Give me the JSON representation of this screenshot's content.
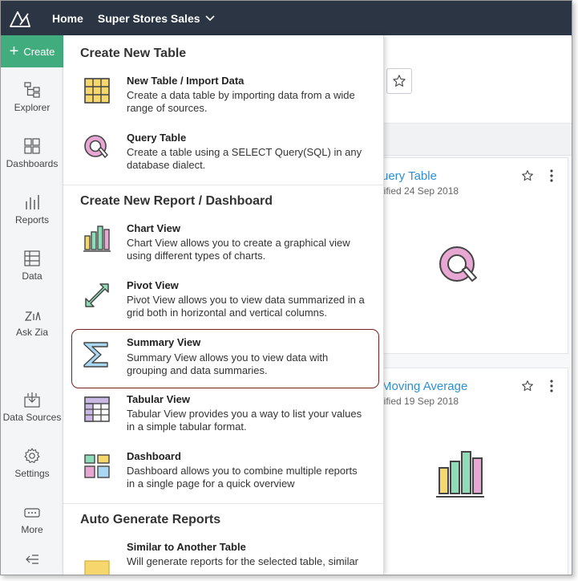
{
  "topbar": {
    "home_label": "Home",
    "workspace_label": "Super Stores Sales"
  },
  "sidebar": {
    "create_label": "Create",
    "items": [
      {
        "label": "Explorer",
        "icon": "explorer-icon"
      },
      {
        "label": "Dashboards",
        "icon": "dashboards-icon"
      },
      {
        "label": "Reports",
        "icon": "reports-icon"
      },
      {
        "label": "Data",
        "icon": "data-icon"
      },
      {
        "label": "Ask Zia",
        "icon": "zia-icon"
      },
      {
        "label": "Data Sources",
        "icon": "data-sources-icon"
      },
      {
        "label": "Settings",
        "icon": "settings-icon"
      },
      {
        "label": "More",
        "icon": "more-icon"
      }
    ]
  },
  "background": {
    "cards": [
      {
        "title": "uery Table",
        "subtitle": "lified 24 Sep 2018",
        "icon": "query-table-icon"
      },
      {
        "title": "Moving Average",
        "subtitle": "lified 19 Sep 2018",
        "icon": "chart-view-icon"
      }
    ]
  },
  "menu": {
    "sections": [
      {
        "title": "Create New Table",
        "items": [
          {
            "title": "New Table / Import Data",
            "desc": "Create a data table by importing data from a wide range of sources.",
            "icon": "table-grid-icon"
          },
          {
            "title": "Query Table",
            "desc": "Create a table using a SELECT Query(SQL) in any database dialect.",
            "icon": "query-table-icon"
          }
        ]
      },
      {
        "title": "Create New Report / Dashboard",
        "items": [
          {
            "title": "Chart View",
            "desc": "Chart View allows you to create a graphical view using different types of charts.",
            "icon": "chart-view-icon"
          },
          {
            "title": "Pivot View",
            "desc": "Pivot View allows you to view data summarized in a grid both in horizontal and vertical columns.",
            "icon": "pivot-view-icon"
          },
          {
            "title": "Summary View",
            "desc": "Summary View allows you to view data with grouping and data summaries.",
            "icon": "summary-sigma-icon",
            "highlighted": true
          },
          {
            "title": "Tabular View",
            "desc": "Tabular View provides you a way to list your values in a simple tabular format.",
            "icon": "tabular-view-icon"
          },
          {
            "title": "Dashboard",
            "desc": "Dashboard allows you to combine multiple reports in a single page for a quick overview",
            "icon": "dashboard-tiles-icon"
          }
        ]
      },
      {
        "title": "Auto Generate Reports",
        "items": [
          {
            "title": "Similar to Another Table",
            "desc": "Will generate reports for the selected table, similar",
            "icon": "auto-generate-icon"
          }
        ]
      }
    ]
  },
  "colors": {
    "topbar": "#2b3543",
    "create": "#41ad7e",
    "link": "#2f8fd2",
    "highlight_border": "#7a1f22",
    "accent_yellow": "#f5d76e",
    "accent_pink": "#e7a7d2",
    "accent_green": "#8fdcb8",
    "accent_blue": "#a9d6f0"
  }
}
